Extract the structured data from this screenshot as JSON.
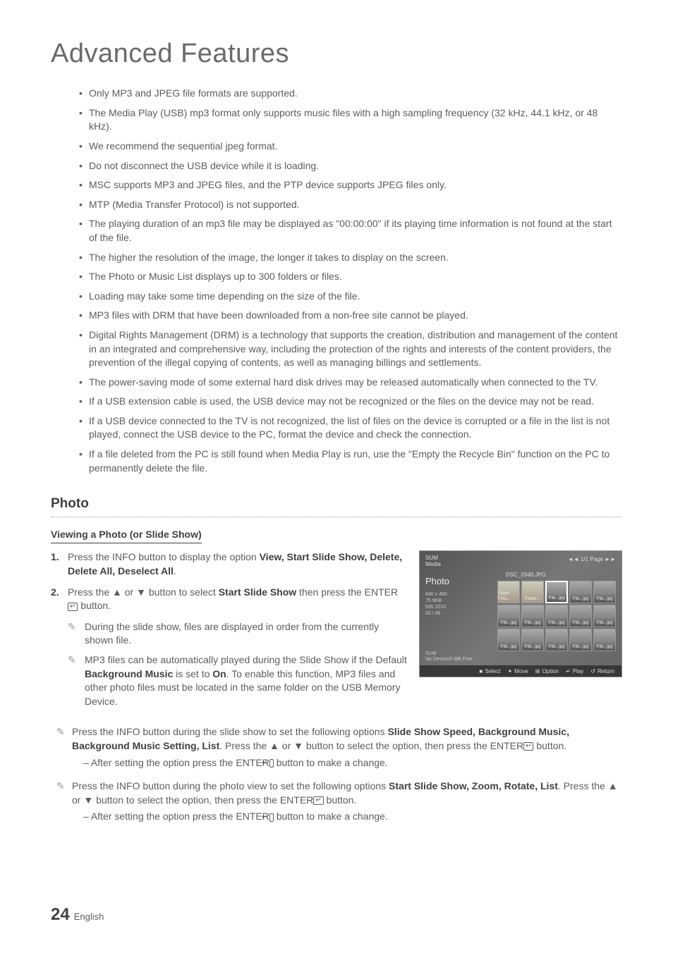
{
  "title": "Advanced Features",
  "bullets": [
    "Only MP3 and JPEG file formats are supported.",
    "The Media Play (USB) mp3 format only supports music files with a high sampling frequency (32 kHz, 44.1 kHz, or 48 kHz).",
    "We recommend the sequential jpeg format.",
    "Do not disconnect the USB device while it is loading.",
    "MSC supports MP3 and JPEG files, and the PTP device supports JPEG files only.",
    "MTP (Media Transfer Protocol) is not supported.",
    "The playing duration of an mp3 file may be displayed as \"00:00:00\" if its playing time information is not found at the start of the file.",
    "The higher the resolution of the image, the longer it takes to display on the screen.",
    "The Photo or Music List displays up to 300 folders or files.",
    "Loading may take some time depending on the size of the file.",
    "MP3 files with DRM that have been downloaded from a non-free site cannot be played.",
    "Digital Rights Management (DRM) is a technology that supports the creation, distribution and management of the content in an integrated and comprehensive way, including the protection of the rights and interests of the content providers, the prevention of the illegal copying of contents, as well as managing billings and settlements.",
    "The power-saving mode of some external hard disk drives may be released automatically when connected to the TV.",
    "If a USB extension cable is used, the USB device may not be recognized or the files on the device may not be read.",
    "If a USB device connected to the TV is not recognized, the list of files on the device is corrupted or a file in the list is not played, connect the USB device to the PC, format the device and check the connection.",
    "If a file deleted from the PC is still found when Media Play is run, use the \"Empty the Recycle Bin\" function on the PC to permanently delete the file."
  ],
  "section": "Photo",
  "subheading": "Viewing a Photo (or Slide Show)",
  "steps": [
    {
      "num": "1.",
      "pre": "Press the INFO button to display the option ",
      "bold": "View, Start Slide Show, Delete, Delete All, Deselect All",
      "post": "."
    },
    {
      "num": "2.",
      "pre": "Press the ▲ or ▼ button to select ",
      "bold": "Start Slide Show",
      "post": " then press the ENTER",
      "post2": " button."
    }
  ],
  "inner_notes": [
    "During the slide show, files are displayed in order from the currently shown file."
  ],
  "inner_note2_pre": "MP3 files can be automatically played during the Slide Show if the Default ",
  "inner_note2_b1": "Background Music",
  "inner_note2_mid": " is set to ",
  "inner_note2_b2": "On",
  "inner_note2_post": ". To enable this function, MP3 files and other photo files must be located in the same folder on the USB Memory Device.",
  "tip1_pre": "Press the INFO button during the slide show to set the following options ",
  "tip1_b": "Slide Show Speed, Background Music, Background Music Setting, List",
  "tip1_mid": ". Press the ▲ or ▼ button to select the option, then press the ENTER",
  "tip1_post": " button.",
  "tip1_dash": "– After setting the option press the ENTER",
  "tip1_dash_post": " button to make a change.",
  "tip2_pre": "Press the INFO button during the photo view to set the following options ",
  "tip2_b": "Start Slide Show, Zoom, Rotate, List",
  "tip2_mid": ". Press the ▲ or ▼ button to select the option, then press the ENTER",
  "tip2_post": " button.",
  "tip2_dash": "– After setting the option press the ENTER",
  "tip2_dash_post": " button to make a change.",
  "screenshot": {
    "sum": "SUM",
    "media": "Media",
    "pageind": "◄◄ 1/1 Page ►►",
    "filename": "DSC_0349.JPG",
    "panel": "Photo",
    "meta1": "640 x 480",
    "meta2": "75.9KB",
    "meta3": "6/8/ 2010",
    "meta4": "33 / 46",
    "sumlabel": "SUM",
    "free": "No Device/0 MB  Free",
    "bar": {
      "select": "Select",
      "move": "Move",
      "option": "Option",
      "play": "Play",
      "return": "Return"
    },
    "thumbs": [
      "Upper Fold...",
      "Folder...",
      "File...jpg",
      "File...jpg",
      "File...jpg",
      "File...jpg",
      "File...jpg",
      "File...jpg",
      "File...jpg",
      "File...jpg",
      "File...jpg",
      "File...jpg",
      "File...jpg",
      "File...jpg",
      "File...jpg"
    ]
  },
  "pageNumber": "24",
  "language": "English",
  "arrows": {
    "up": "▲",
    "down": "▼"
  }
}
